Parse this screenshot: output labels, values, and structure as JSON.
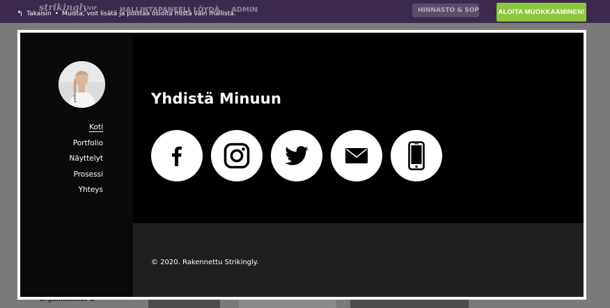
{
  "background_app": {
    "logo": "strikingly",
    "vip_badge": "VIP",
    "nav": [
      "HALLINTAPANEELI",
      "LÖYDÄ",
      "ADMIN"
    ],
    "pricing_button": "HINNASTO & SOPI",
    "lower_left_text": "Organisaatiot &"
  },
  "overlay": {
    "back_label": "Takaisin",
    "separator": "•",
    "hint_text": "Muista, voit lisätä ja poistaa osioita mistä vain mallista.",
    "start_button": "ALOITA MUOKKAAMINEN!",
    "start_button_color": "#8dc63f"
  },
  "site": {
    "menu": [
      {
        "label": "Koti",
        "active": true
      },
      {
        "label": "Portfolio",
        "active": false
      },
      {
        "label": "Näyttelyt",
        "active": false
      },
      {
        "label": "Prosessi",
        "active": false
      },
      {
        "label": "Yhteys",
        "active": false
      }
    ],
    "section_title": "Yhdistä Minuun",
    "social_icons": [
      "facebook-icon",
      "instagram-icon",
      "twitter-icon",
      "email-icon",
      "phone-icon"
    ],
    "footer_text": "© 2020. Rakennettu Strikingly."
  }
}
